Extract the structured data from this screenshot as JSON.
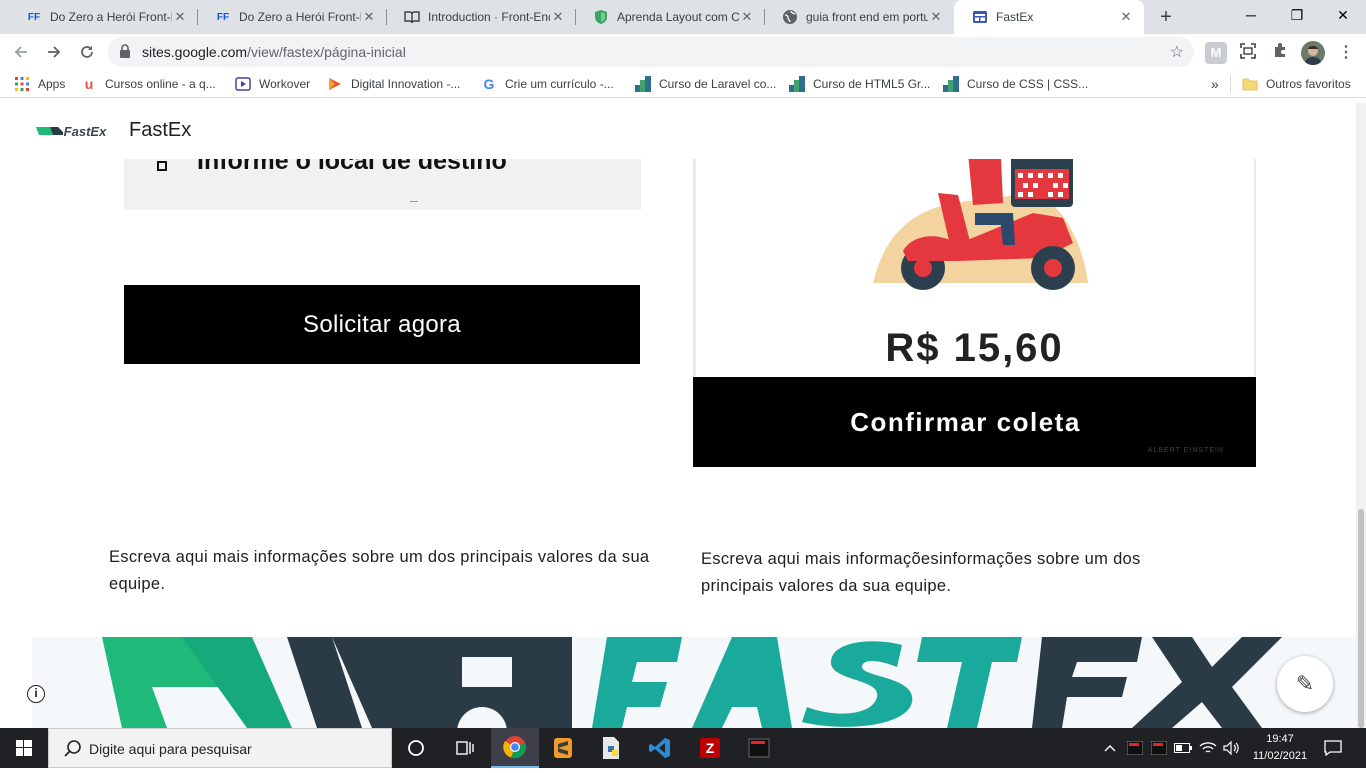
{
  "browser": {
    "tabs": [
      {
        "title": "Do Zero a Herói Front-E",
        "favicon": "FF",
        "active": false
      },
      {
        "title": "Do Zero a Herói Front-E",
        "favicon": "FF",
        "active": false
      },
      {
        "title": "Introduction · Front-End",
        "favicon": "book-icon",
        "active": false
      },
      {
        "title": "Aprenda Layout com CSS",
        "favicon": "shield-icon",
        "active": false
      },
      {
        "title": "guia front end em portu",
        "favicon": "globe-icon",
        "active": false
      },
      {
        "title": "FastEx",
        "favicon": "sites-icon",
        "active": true
      }
    ],
    "new_tab": "+",
    "window_controls": {
      "minimize": "─",
      "maximize": "❐",
      "close": "✕"
    },
    "url_host": "sites.google.com",
    "url_path": "/view/fastex/página-inicial",
    "bookmarks": [
      {
        "label": "Apps"
      },
      {
        "label": "Cursos online - a q..."
      },
      {
        "label": "Workover"
      },
      {
        "label": "Digital Innovation -..."
      },
      {
        "label": "Crie um currículo -..."
      },
      {
        "label": "Curso de Laravel co..."
      },
      {
        "label": "Curso de HTML5 Gr..."
      },
      {
        "label": "Curso de CSS | CSS..."
      }
    ],
    "bookmarks_overflow": "»",
    "other_bookmarks": "Outros favoritos",
    "extension_badge": "M"
  },
  "site": {
    "logo_text": "FastEx",
    "title": "FastEx",
    "card_top_text": "Informe o local de destino",
    "request_button": "Solicitar agora",
    "price": "R$ 15,60",
    "confirm_button": "Confirmar coleta",
    "quote_author": "ALBERT EINSTEIN",
    "info_left": "Escreva aqui mais informações sobre um dos principais valores da sua equipe.",
    "info_right": "Escreva aqui mais informaçõesinformações sobre um dos principais valores da sua equipe.",
    "banner_text": "FastEx",
    "info_icon": "i",
    "edit_icon": "✎"
  },
  "taskbar": {
    "search_placeholder": "Digite aqui para pesquisar",
    "time": "19:47",
    "date": "11/02/2021"
  },
  "colors": {
    "accent_green": "#1fba7a",
    "accent_teal": "#1aaa9c",
    "dark_truck": "#2b3b45",
    "scooter_red": "#e5373e"
  }
}
